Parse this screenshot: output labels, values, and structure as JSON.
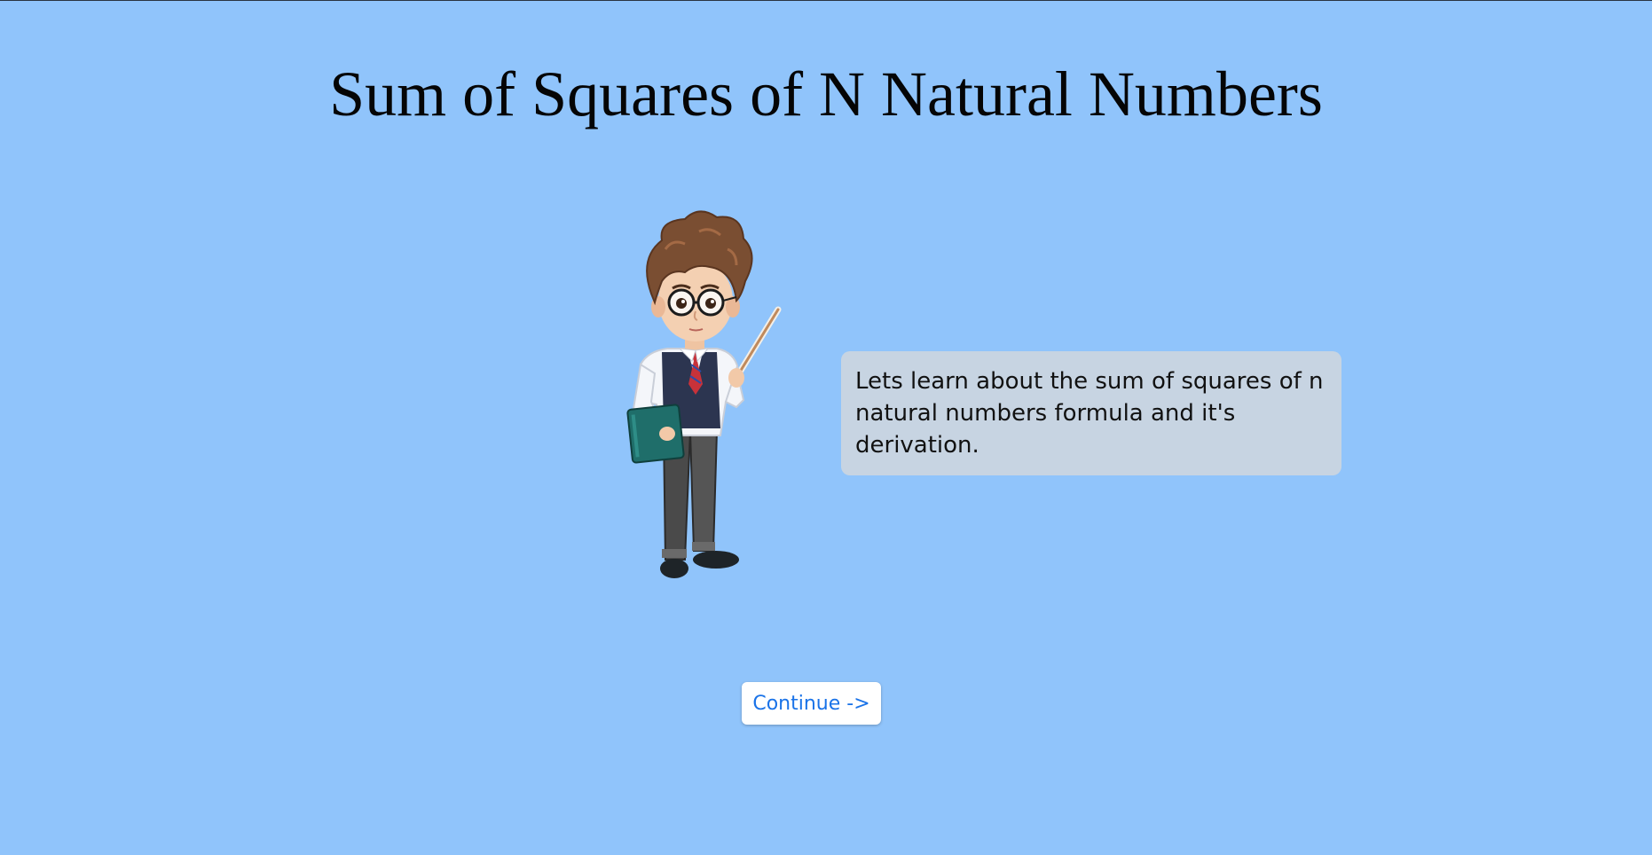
{
  "page": {
    "title": "Sum of Squares of N Natural Numbers",
    "background_color": "#90c4fb"
  },
  "illustration": {
    "icon": "teacher-boy-with-pointer-icon"
  },
  "speech_bubble": {
    "text": "Lets learn about the sum of squares of n natural numbers formula and it's derivation.",
    "background_color": "#c7d4e2"
  },
  "continue_button": {
    "label": "Continue ->",
    "text_color": "#1a73e8"
  }
}
